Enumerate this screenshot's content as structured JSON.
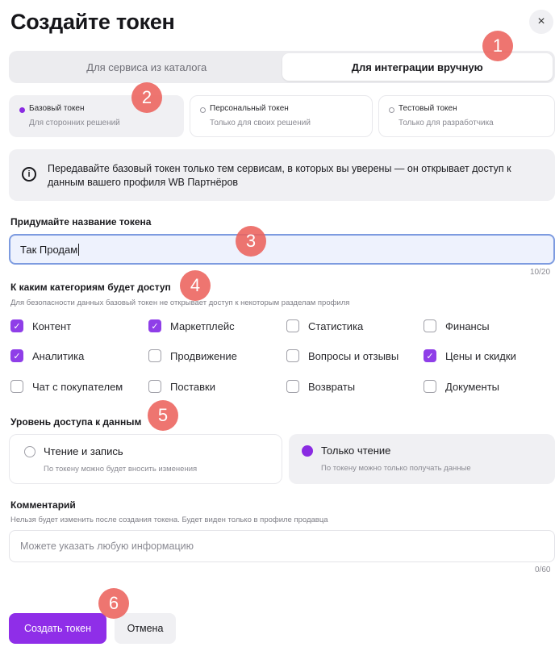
{
  "dialog": {
    "title": "Создайте токен",
    "close": "×"
  },
  "tabs": [
    {
      "label": "Для сервиса из каталога",
      "active": false
    },
    {
      "label": "Для интеграции вручную",
      "active": true
    }
  ],
  "token_types": [
    {
      "title": "Базовый токен",
      "subtitle": "Для сторонних решений",
      "selected": true
    },
    {
      "title": "Персональный токен",
      "subtitle": "Только для своих решений",
      "selected": false
    },
    {
      "title": "Тестовый токен",
      "subtitle": "Только для разработчика",
      "selected": false
    }
  ],
  "info": {
    "icon": "info-icon",
    "text": "Передавайте базовый токен только тем сервисам, в которых вы уверены — он открывает доступ к данным вашего профиля WB Партнёров"
  },
  "token_name": {
    "label": "Придумайте название токена",
    "value": "Так Продам",
    "counter": "10/20"
  },
  "categories": {
    "label": "К каким категориям будет доступ",
    "hint": "Для безопасности данных базовый токен не открывает доступ к некоторым разделам профиля",
    "items": [
      {
        "label": "Контент",
        "checked": true
      },
      {
        "label": "Маркетплейс",
        "checked": true
      },
      {
        "label": "Статистика",
        "checked": false
      },
      {
        "label": "Финансы",
        "checked": false
      },
      {
        "label": "Аналитика",
        "checked": true
      },
      {
        "label": "Продвижение",
        "checked": false
      },
      {
        "label": "Вопросы и отзывы",
        "checked": false
      },
      {
        "label": "Цены и скидки",
        "checked": true
      },
      {
        "label": "Чат с покупателем",
        "checked": false
      },
      {
        "label": "Поставки",
        "checked": false
      },
      {
        "label": "Возвраты",
        "checked": false
      },
      {
        "label": "Документы",
        "checked": false
      }
    ]
  },
  "access": {
    "label": "Уровень доступа к данным",
    "options": [
      {
        "title": "Чтение и запись",
        "subtitle": "По токену можно будет вносить изменения",
        "selected": false
      },
      {
        "title": "Только чтение",
        "subtitle": "По токену можно только получать данные",
        "selected": true
      }
    ]
  },
  "comment": {
    "label": "Комментарий",
    "hint": "Нельзя будет изменить после создания токена. Будет виден только в профиле продавца",
    "placeholder": "Можете указать любую информацию",
    "counter": "0/60"
  },
  "buttons": {
    "create": "Создать токен",
    "cancel": "Отмена"
  },
  "markers": [
    "1",
    "2",
    "3",
    "4",
    "5",
    "6"
  ],
  "colors": {
    "accent": "#8f2ee8",
    "marker": "#ec625c",
    "focus_border": "#7d9be0"
  }
}
